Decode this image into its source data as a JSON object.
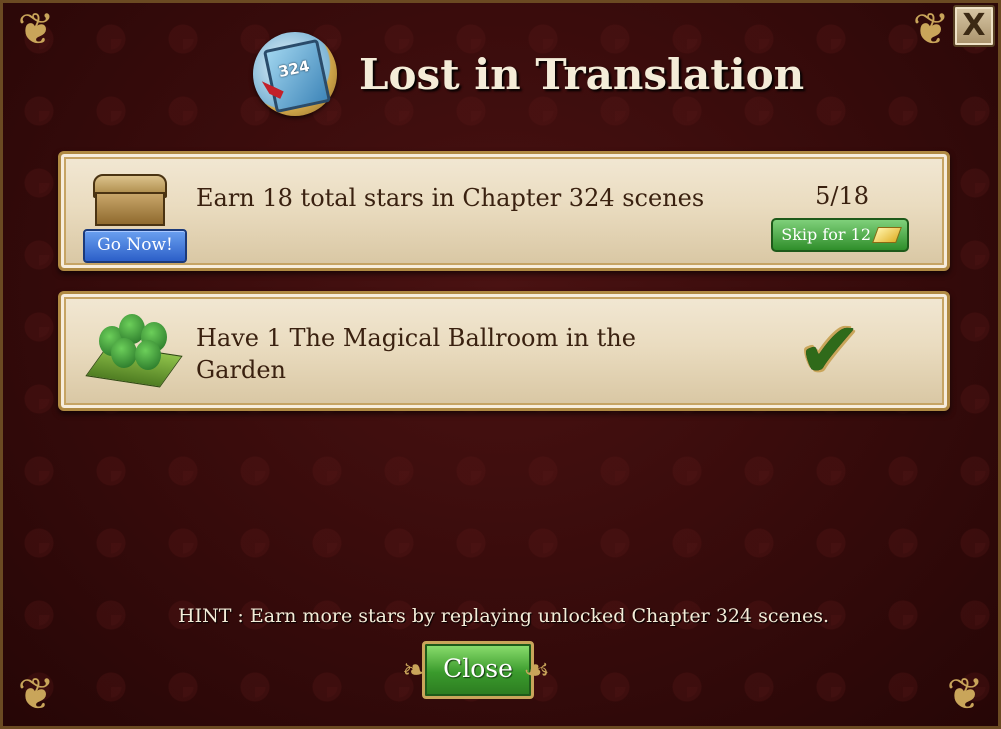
{
  "dialog": {
    "title": "Lost in Translation",
    "book_number": "324",
    "close_x_label": "X"
  },
  "goals": [
    {
      "text": "Earn 18 total stars in Chapter 324 scenes",
      "progress": "5/18",
      "go_label": "Go Now!",
      "skip_label": "Skip for 12",
      "icon": "treasure-chest-icon"
    },
    {
      "text": "Have 1 The Magical Ballroom in the Garden",
      "completed": true,
      "icon": "garden-trees-icon"
    }
  ],
  "hint": "HINT : Earn more stars by replaying unlocked Chapter 324 scenes.",
  "footer": {
    "close_label": "Close"
  }
}
